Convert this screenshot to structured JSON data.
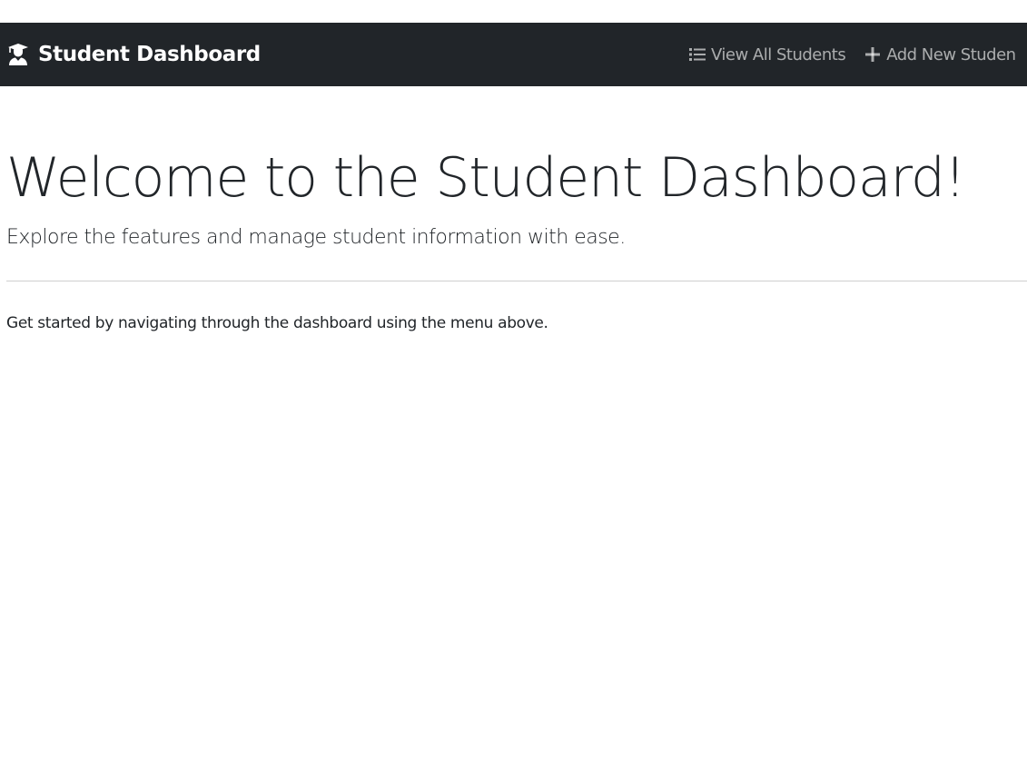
{
  "navbar": {
    "brand": {
      "label": "Student Dashboard",
      "icon": "graduate-icon"
    },
    "links": [
      {
        "label": "View All Students",
        "icon": "list-icon"
      },
      {
        "label": "Add New Studen",
        "icon": "plus-icon"
      }
    ]
  },
  "hero": {
    "title": "Welcome to the Student Dashboard!",
    "lead": "Explore the features and manage student information with ease.",
    "body": "Get started by navigating through the dashboard using the menu above."
  },
  "colors": {
    "navbar_bg": "#212529",
    "brand_text": "#ffffff",
    "nav_link_text": "rgba(255,255,255,0.62)",
    "body_text": "#212529",
    "divider": "#cfcfcf"
  }
}
